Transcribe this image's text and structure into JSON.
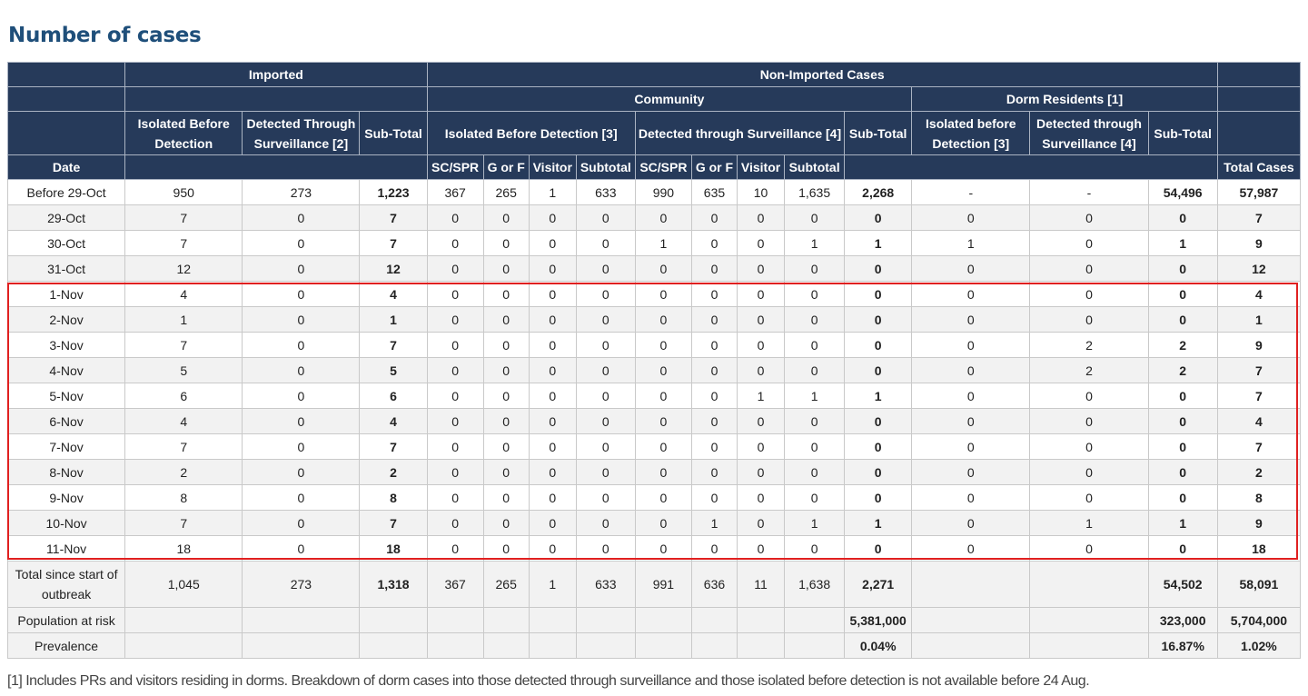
{
  "title": "Number of cases",
  "header": {
    "imported": "Imported",
    "non_imported": "Non-Imported Cases",
    "community": "Community",
    "dorm_residents": "Dorm Residents [1]",
    "isolated_before_detection": "Isolated Before Detection",
    "detected_through_surveillance_2": "Detected Through Surveillance [2]",
    "sub_total": "Sub-Total",
    "comm_isolated_before_detection": "Isolated Before Detection [3]",
    "comm_detected_through_surveillance": "Detected through Surveillance [4]",
    "dorm_isolated_before_detection": "Isolated before Detection [3]",
    "dorm_detected_through_surveillance": "Detected through Surveillance [4]",
    "date": "Date",
    "sc_spr": "SC/SPR",
    "g_or_f": "G or F",
    "visitor": "Visitor",
    "subtotal": "Subtotal",
    "total_cases": "Total Cases"
  },
  "rows": [
    [
      "Before 29-Oct",
      "950",
      "273",
      "1,223",
      "367",
      "265",
      "1",
      "633",
      "990",
      "635",
      "10",
      "1,635",
      "2,268",
      "-",
      "-",
      "54,496",
      "57,987"
    ],
    [
      "29-Oct",
      "7",
      "0",
      "7",
      "0",
      "0",
      "0",
      "0",
      "0",
      "0",
      "0",
      "0",
      "0",
      "0",
      "0",
      "0",
      "7"
    ],
    [
      "30-Oct",
      "7",
      "0",
      "7",
      "0",
      "0",
      "0",
      "0",
      "1",
      "0",
      "0",
      "1",
      "1",
      "1",
      "0",
      "1",
      "9"
    ],
    [
      "31-Oct",
      "12",
      "0",
      "12",
      "0",
      "0",
      "0",
      "0",
      "0",
      "0",
      "0",
      "0",
      "0",
      "0",
      "0",
      "0",
      "12"
    ],
    [
      "1-Nov",
      "4",
      "0",
      "4",
      "0",
      "0",
      "0",
      "0",
      "0",
      "0",
      "0",
      "0",
      "0",
      "0",
      "0",
      "0",
      "4"
    ],
    [
      "2-Nov",
      "1",
      "0",
      "1",
      "0",
      "0",
      "0",
      "0",
      "0",
      "0",
      "0",
      "0",
      "0",
      "0",
      "0",
      "0",
      "1"
    ],
    [
      "3-Nov",
      "7",
      "0",
      "7",
      "0",
      "0",
      "0",
      "0",
      "0",
      "0",
      "0",
      "0",
      "0",
      "0",
      "2",
      "2",
      "9"
    ],
    [
      "4-Nov",
      "5",
      "0",
      "5",
      "0",
      "0",
      "0",
      "0",
      "0",
      "0",
      "0",
      "0",
      "0",
      "0",
      "2",
      "2",
      "7"
    ],
    [
      "5-Nov",
      "6",
      "0",
      "6",
      "0",
      "0",
      "0",
      "0",
      "0",
      "0",
      "1",
      "1",
      "1",
      "0",
      "0",
      "0",
      "7"
    ],
    [
      "6-Nov",
      "4",
      "0",
      "4",
      "0",
      "0",
      "0",
      "0",
      "0",
      "0",
      "0",
      "0",
      "0",
      "0",
      "0",
      "0",
      "4"
    ],
    [
      "7-Nov",
      "7",
      "0",
      "7",
      "0",
      "0",
      "0",
      "0",
      "0",
      "0",
      "0",
      "0",
      "0",
      "0",
      "0",
      "0",
      "7"
    ],
    [
      "8-Nov",
      "2",
      "0",
      "2",
      "0",
      "0",
      "0",
      "0",
      "0",
      "0",
      "0",
      "0",
      "0",
      "0",
      "0",
      "0",
      "2"
    ],
    [
      "9-Nov",
      "8",
      "0",
      "8",
      "0",
      "0",
      "0",
      "0",
      "0",
      "0",
      "0",
      "0",
      "0",
      "0",
      "0",
      "0",
      "8"
    ],
    [
      "10-Nov",
      "7",
      "0",
      "7",
      "0",
      "0",
      "0",
      "0",
      "0",
      "1",
      "0",
      "1",
      "1",
      "0",
      "1",
      "1",
      "9"
    ],
    [
      "11-Nov",
      "18",
      "0",
      "18",
      "0",
      "0",
      "0",
      "0",
      "0",
      "0",
      "0",
      "0",
      "0",
      "0",
      "0",
      "0",
      "18"
    ]
  ],
  "totals": [
    "Total since start of outbreak",
    "1,045",
    "273",
    "1,318",
    "367",
    "265",
    "1",
    "633",
    "991",
    "636",
    "11",
    "1,638",
    "2,271",
    "",
    "",
    "54,502",
    "58,091"
  ],
  "population": [
    "Population at risk",
    "",
    "",
    "",
    "",
    "",
    "",
    "",
    "",
    "",
    "",
    "",
    "5,381,000",
    "",
    "",
    "323,000",
    "5,704,000"
  ],
  "prevalence": [
    "Prevalence",
    "",
    "",
    "",
    "",
    "",
    "",
    "",
    "",
    "",
    "",
    "",
    "0.04%",
    "",
    "",
    "16.87%",
    "1.02%"
  ],
  "footnote": "[1] Includes PRs and visitors residing in dorms. Breakdown of dorm cases into those detected through surveillance and those isolated before detection is not available before 24 Aug."
}
